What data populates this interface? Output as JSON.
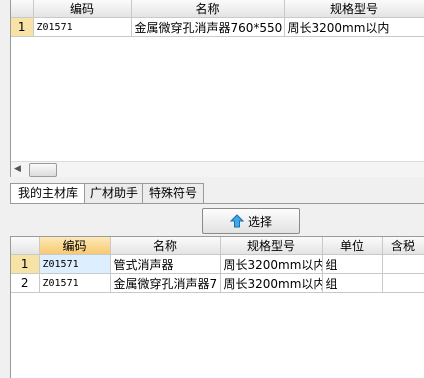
{
  "top_grid": {
    "headers": [
      "",
      "编码",
      "名称",
      "规格型号"
    ],
    "rows": [
      {
        "num": "1",
        "code": "Z01571",
        "name": "金属微穿孔消声器760*550",
        "spec": "周长3200mm以内"
      }
    ]
  },
  "tabs": [
    {
      "label": "我的主材库"
    },
    {
      "label": "广材助手"
    },
    {
      "label": "特殊符号"
    }
  ],
  "select_button": {
    "label": "选择",
    "icon": "up-arrow-icon"
  },
  "bottom_grid": {
    "headers": [
      "",
      "编码",
      "名称",
      "规格型号",
      "单位",
      "含税"
    ],
    "rows": [
      {
        "num": "1",
        "code": "Z01571",
        "name": "管式消声器",
        "spec": "周长3200mm以内",
        "unit": "组"
      },
      {
        "num": "2",
        "code": "Z01571",
        "name": "金属微穿孔消声器7",
        "spec": "周长3200mm以内",
        "unit": "组"
      }
    ]
  },
  "colors": {
    "header_selected": "#f6c971",
    "row_selected": "#f7e3a6",
    "cell_selected": "#ddeeff"
  }
}
